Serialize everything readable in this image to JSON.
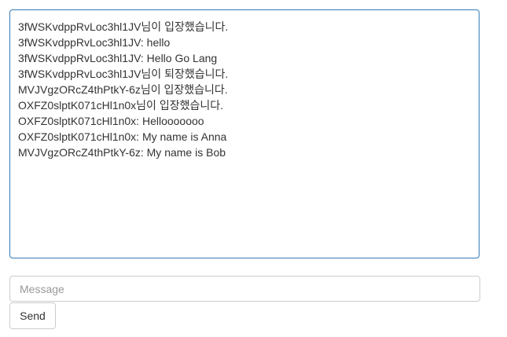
{
  "chat": {
    "messages": [
      "3fWSKvdppRvLoc3hl1JV님이 입장했습니다.",
      "3fWSKvdppRvLoc3hl1JV: hello",
      "3fWSKvdppRvLoc3hl1JV: Hello Go Lang",
      "3fWSKvdppRvLoc3hl1JV님이 퇴장했습니다.",
      "MVJVgzORcZ4thPtkY-6z님이 입장했습니다.",
      "OXFZ0slptK071cHl1n0x님이 입장했습니다.",
      "OXFZ0slptK071cHl1n0x: Hellooooooo",
      "OXFZ0slptK071cHl1n0x: My name is Anna",
      "MVJVgzORcZ4thPtkY-6z: My name is Bob"
    ]
  },
  "composer": {
    "placeholder": "Message",
    "value": "",
    "send_label": "Send"
  },
  "colors": {
    "log_border": "#337ab7",
    "input_border": "#cccccc",
    "text": "#333333"
  }
}
